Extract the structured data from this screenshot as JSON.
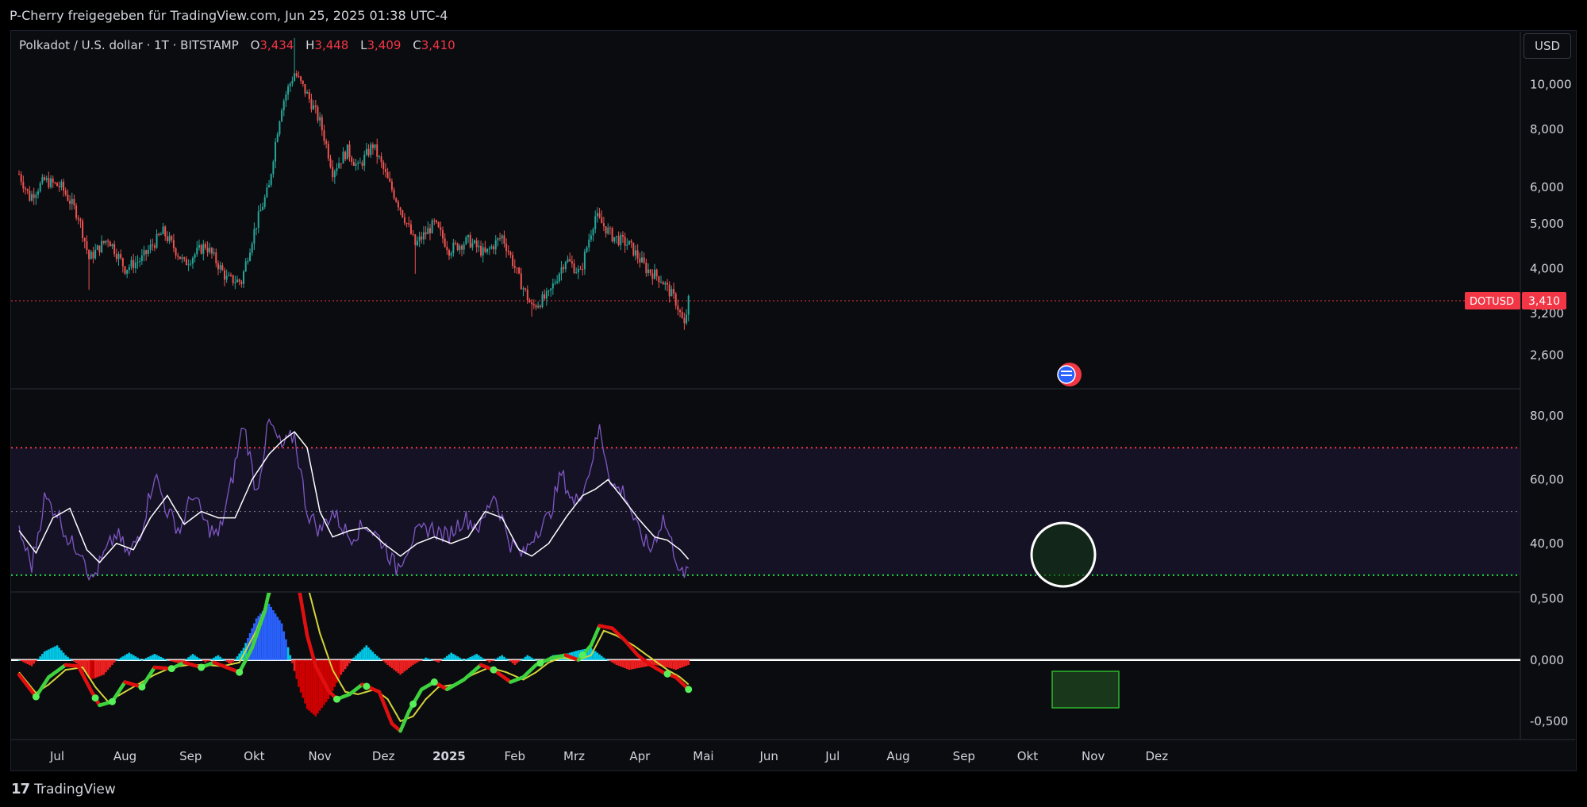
{
  "header": {
    "attribution": "P-Cherry freigegeben für TradingView.com, Jun 25, 2025 01:38 UTC-4"
  },
  "legend": {
    "symbol": "Polkadot / U.S. dollar · 1T · BITSTAMP",
    "o_label": "O",
    "o_value": "3,434",
    "h_label": "H",
    "h_value": "3,448",
    "l_label": "L",
    "l_value": "3,409",
    "c_label": "C",
    "c_value": "3,410"
  },
  "currency_button": "USD",
  "price_tag": {
    "symbol": "DOTUSD",
    "value": "3,410"
  },
  "footer": {
    "brand": "TradingView",
    "logo_mark": "17"
  },
  "colors": {
    "up": "#26a69a",
    "down": "#ef5350",
    "rsi": "#7e57c2",
    "rsi_ma": "#ffffff",
    "upper_band": "#f23645",
    "lower_band": "#22dd44",
    "tag": "#f23645"
  },
  "chart_data": [
    {
      "type": "candlestick",
      "name": "price",
      "scale": "log",
      "ylim": [
        2200,
        13000
      ],
      "y_ticks": [
        {
          "v": 10000,
          "label": "10,000"
        },
        {
          "v": 8000,
          "label": "8,000"
        },
        {
          "v": 6000,
          "label": "6,000"
        },
        {
          "v": 5000,
          "label": "5,000"
        },
        {
          "v": 4000,
          "label": "4,000"
        },
        {
          "v": 3200,
          "label": "3,200"
        },
        {
          "v": 2600,
          "label": "2,600"
        }
      ],
      "last_value": 3410,
      "close_anchors": [
        [
          0,
          6400
        ],
        [
          5,
          5700
        ],
        [
          12,
          6200
        ],
        [
          20,
          6000
        ],
        [
          28,
          5200
        ],
        [
          33,
          4200
        ],
        [
          42,
          4650
        ],
        [
          50,
          4000
        ],
        [
          58,
          4200
        ],
        [
          68,
          4800
        ],
        [
          78,
          4100
        ],
        [
          88,
          4500
        ],
        [
          98,
          3800
        ],
        [
          105,
          3750
        ],
        [
          112,
          5000
        ],
        [
          118,
          6000
        ],
        [
          124,
          9000
        ],
        [
          130,
          10600
        ],
        [
          136,
          9500
        ],
        [
          142,
          8300
        ],
        [
          148,
          6500
        ],
        [
          155,
          7200
        ],
        [
          160,
          6600
        ],
        [
          167,
          7400
        ],
        [
          174,
          6200
        ],
        [
          180,
          5400
        ],
        [
          187,
          4500
        ],
        [
          196,
          5000
        ],
        [
          203,
          4400
        ],
        [
          212,
          4600
        ],
        [
          220,
          4300
        ],
        [
          228,
          4700
        ],
        [
          236,
          3800
        ],
        [
          242,
          3300
        ],
        [
          250,
          3500
        ],
        [
          258,
          4200
        ],
        [
          265,
          3900
        ],
        [
          272,
          5200
        ],
        [
          280,
          4700
        ],
        [
          288,
          4500
        ],
        [
          296,
          4000
        ],
        [
          303,
          3800
        ],
        [
          310,
          3400
        ],
        [
          314,
          3000
        ],
        [
          316,
          3410
        ]
      ],
      "wick_extremes": [
        {
          "i": 33,
          "low": 3600
        },
        {
          "i": 130,
          "high": 12600
        },
        {
          "i": 187,
          "low": 3900
        },
        {
          "i": 242,
          "low": 3150
        },
        {
          "i": 314,
          "low": 2950
        }
      ]
    },
    {
      "type": "line",
      "name": "rsi",
      "ylim": [
        25,
        88
      ],
      "y_ticks": [
        {
          "v": 80,
          "label": "80,00"
        },
        {
          "v": 60,
          "label": "60,00"
        },
        {
          "v": 40,
          "label": "40,00"
        }
      ],
      "bands": {
        "upper": 70,
        "mid": 50,
        "lower": 30
      },
      "rsi_anchors": [
        [
          0,
          44
        ],
        [
          6,
          33
        ],
        [
          12,
          54
        ],
        [
          18,
          50
        ],
        [
          24,
          40
        ],
        [
          30,
          38
        ],
        [
          34,
          28
        ],
        [
          40,
          36
        ],
        [
          46,
          43
        ],
        [
          52,
          36
        ],
        [
          58,
          45
        ],
        [
          64,
          62
        ],
        [
          70,
          50
        ],
        [
          76,
          44
        ],
        [
          82,
          56
        ],
        [
          88,
          46
        ],
        [
          94,
          42
        ],
        [
          100,
          58
        ],
        [
          106,
          78
        ],
        [
          112,
          56
        ],
        [
          118,
          78
        ],
        [
          124,
          70
        ],
        [
          130,
          74
        ],
        [
          136,
          50
        ],
        [
          142,
          44
        ],
        [
          148,
          50
        ],
        [
          156,
          42
        ],
        [
          164,
          46
        ],
        [
          172,
          40
        ],
        [
          178,
          32
        ],
        [
          186,
          42
        ],
        [
          194,
          45
        ],
        [
          202,
          42
        ],
        [
          210,
          48
        ],
        [
          218,
          45
        ],
        [
          224,
          56
        ],
        [
          232,
          40
        ],
        [
          238,
          36
        ],
        [
          244,
          44
        ],
        [
          250,
          48
        ],
        [
          256,
          62
        ],
        [
          262,
          52
        ],
        [
          268,
          60
        ],
        [
          274,
          76
        ],
        [
          280,
          58
        ],
        [
          286,
          56
        ],
        [
          292,
          44
        ],
        [
          298,
          38
        ],
        [
          304,
          48
        ],
        [
          310,
          36
        ],
        [
          314,
          28
        ],
        [
          316,
          34
        ]
      ],
      "ma_anchors": [
        [
          0,
          44
        ],
        [
          8,
          37
        ],
        [
          16,
          48
        ],
        [
          24,
          51
        ],
        [
          32,
          38
        ],
        [
          38,
          34
        ],
        [
          46,
          40
        ],
        [
          54,
          38
        ],
        [
          62,
          48
        ],
        [
          70,
          55
        ],
        [
          78,
          46
        ],
        [
          86,
          50
        ],
        [
          94,
          48
        ],
        [
          102,
          48
        ],
        [
          110,
          60
        ],
        [
          118,
          68
        ],
        [
          124,
          72
        ],
        [
          130,
          75
        ],
        [
          136,
          70
        ],
        [
          142,
          50
        ],
        [
          148,
          42
        ],
        [
          156,
          44
        ],
        [
          164,
          45
        ],
        [
          172,
          40
        ],
        [
          180,
          36
        ],
        [
          188,
          40
        ],
        [
          196,
          42
        ],
        [
          204,
          40
        ],
        [
          212,
          42
        ],
        [
          220,
          50
        ],
        [
          228,
          48
        ],
        [
          236,
          38
        ],
        [
          242,
          36
        ],
        [
          250,
          40
        ],
        [
          258,
          48
        ],
        [
          266,
          55
        ],
        [
          272,
          57
        ],
        [
          278,
          60
        ],
        [
          284,
          55
        ],
        [
          292,
          48
        ],
        [
          300,
          42
        ],
        [
          306,
          41
        ],
        [
          312,
          38
        ],
        [
          316,
          35
        ]
      ]
    },
    {
      "type": "histogram+line",
      "name": "wavetrend",
      "ylim": [
        -0.65,
        0.55
      ],
      "y_ticks": [
        {
          "v": 0.5,
          "label": "0,500"
        },
        {
          "v": 0,
          "label": "0,000"
        },
        {
          "v": -0.5,
          "label": "-0,500"
        }
      ],
      "fast_anchors": [
        [
          0,
          -0.12
        ],
        [
          8,
          -0.3
        ],
        [
          14,
          -0.14
        ],
        [
          22,
          -0.04
        ],
        [
          28,
          -0.05
        ],
        [
          34,
          -0.25
        ],
        [
          38,
          -0.37
        ],
        [
          44,
          -0.34
        ],
        [
          50,
          -0.18
        ],
        [
          58,
          -0.22
        ],
        [
          64,
          -0.06
        ],
        [
          72,
          -0.07
        ],
        [
          78,
          -0.02
        ],
        [
          86,
          -0.06
        ],
        [
          92,
          -0.02
        ],
        [
          98,
          -0.06
        ],
        [
          104,
          -0.1
        ],
        [
          110,
          0.1
        ],
        [
          116,
          0.4
        ],
        [
          120,
          0.72
        ],
        [
          126,
          0.9
        ],
        [
          130,
          0.8
        ],
        [
          136,
          0.2
        ],
        [
          140,
          -0.05
        ],
        [
          146,
          -0.25
        ],
        [
          150,
          -0.32
        ],
        [
          156,
          -0.28
        ],
        [
          162,
          -0.2
        ],
        [
          170,
          -0.26
        ],
        [
          176,
          -0.52
        ],
        [
          180,
          -0.58
        ],
        [
          184,
          -0.42
        ],
        [
          190,
          -0.24
        ],
        [
          196,
          -0.18
        ],
        [
          202,
          -0.24
        ],
        [
          210,
          -0.16
        ],
        [
          218,
          -0.04
        ],
        [
          224,
          -0.08
        ],
        [
          232,
          -0.18
        ],
        [
          238,
          -0.14
        ],
        [
          244,
          -0.04
        ],
        [
          252,
          0.02
        ],
        [
          258,
          0.04
        ],
        [
          264,
          0.0
        ],
        [
          270,
          0.12
        ],
        [
          274,
          0.28
        ],
        [
          280,
          0.26
        ],
        [
          286,
          0.16
        ],
        [
          292,
          0.04
        ],
        [
          298,
          -0.04
        ],
        [
          304,
          -0.1
        ],
        [
          310,
          -0.14
        ],
        [
          316,
          -0.24
        ]
      ],
      "slow_anchors": [
        [
          0,
          -0.1
        ],
        [
          8,
          -0.27
        ],
        [
          14,
          -0.2
        ],
        [
          22,
          -0.08
        ],
        [
          30,
          -0.06
        ],
        [
          36,
          -0.22
        ],
        [
          42,
          -0.34
        ],
        [
          48,
          -0.28
        ],
        [
          56,
          -0.2
        ],
        [
          64,
          -0.12
        ],
        [
          72,
          -0.06
        ],
        [
          80,
          -0.04
        ],
        [
          88,
          -0.04
        ],
        [
          96,
          -0.05
        ],
        [
          104,
          -0.02
        ],
        [
          112,
          0.24
        ],
        [
          118,
          0.52
        ],
        [
          124,
          0.86
        ],
        [
          130,
          0.92
        ],
        [
          136,
          0.62
        ],
        [
          142,
          0.22
        ],
        [
          148,
          -0.08
        ],
        [
          154,
          -0.26
        ],
        [
          160,
          -0.28
        ],
        [
          168,
          -0.24
        ],
        [
          174,
          -0.32
        ],
        [
          180,
          -0.5
        ],
        [
          186,
          -0.46
        ],
        [
          192,
          -0.32
        ],
        [
          198,
          -0.22
        ],
        [
          206,
          -0.2
        ],
        [
          214,
          -0.12
        ],
        [
          222,
          -0.06
        ],
        [
          230,
          -0.1
        ],
        [
          238,
          -0.16
        ],
        [
          244,
          -0.1
        ],
        [
          250,
          -0.02
        ],
        [
          256,
          0.02
        ],
        [
          264,
          0.0
        ],
        [
          270,
          0.04
        ],
        [
          276,
          0.24
        ],
        [
          282,
          0.2
        ],
        [
          290,
          0.12
        ],
        [
          298,
          0.02
        ],
        [
          306,
          -0.08
        ],
        [
          312,
          -0.14
        ],
        [
          316,
          -0.2
        ]
      ],
      "hist_anchors": [
        [
          0,
          0.0
        ],
        [
          6,
          -0.05
        ],
        [
          12,
          0.07
        ],
        [
          18,
          0.12
        ],
        [
          22,
          0.04
        ],
        [
          28,
          -0.04
        ],
        [
          34,
          -0.16
        ],
        [
          40,
          -0.12
        ],
        [
          46,
          0.0
        ],
        [
          52,
          0.06
        ],
        [
          58,
          0.0
        ],
        [
          64,
          0.05
        ],
        [
          70,
          0.0
        ],
        [
          76,
          -0.03
        ],
        [
          82,
          0.05
        ],
        [
          88,
          -0.02
        ],
        [
          94,
          0.04
        ],
        [
          100,
          -0.04
        ],
        [
          106,
          0.1
        ],
        [
          112,
          0.34
        ],
        [
          118,
          0.46
        ],
        [
          124,
          0.3
        ],
        [
          128,
          0.04
        ],
        [
          132,
          -0.22
        ],
        [
          136,
          -0.4
        ],
        [
          140,
          -0.46
        ],
        [
          146,
          -0.32
        ],
        [
          152,
          -0.12
        ],
        [
          158,
          0.02
        ],
        [
          164,
          0.12
        ],
        [
          168,
          0.05
        ],
        [
          174,
          -0.04
        ],
        [
          180,
          -0.12
        ],
        [
          186,
          -0.04
        ],
        [
          192,
          0.02
        ],
        [
          198,
          -0.02
        ],
        [
          204,
          0.06
        ],
        [
          210,
          0.0
        ],
        [
          216,
          0.05
        ],
        [
          222,
          -0.02
        ],
        [
          228,
          0.04
        ],
        [
          234,
          -0.04
        ],
        [
          240,
          0.04
        ],
        [
          246,
          -0.02
        ],
        [
          252,
          0.04
        ],
        [
          258,
          0.05
        ],
        [
          264,
          0.08
        ],
        [
          270,
          0.1
        ],
        [
          276,
          0.02
        ],
        [
          282,
          -0.04
        ],
        [
          288,
          -0.08
        ],
        [
          294,
          -0.06
        ],
        [
          300,
          -0.04
        ],
        [
          306,
          -0.06
        ],
        [
          310,
          -0.08
        ],
        [
          316,
          -0.04
        ]
      ],
      "cross_dots": [
        8,
        36,
        44,
        58,
        72,
        86,
        104,
        150,
        164,
        186,
        196,
        224,
        246,
        266,
        306,
        316
      ]
    }
  ],
  "x_axis": {
    "ticks": [
      {
        "i": 18,
        "label": "Jul"
      },
      {
        "i": 50,
        "label": "Aug"
      },
      {
        "i": 81,
        "label": "Sep"
      },
      {
        "i": 111,
        "label": "Okt"
      },
      {
        "i": 142,
        "label": "Nov"
      },
      {
        "i": 172,
        "label": "Dez"
      },
      {
        "i": 203,
        "label": "2025",
        "bold": true
      },
      {
        "i": 234,
        "label": "Feb"
      },
      {
        "i": 262,
        "label": "Mrz"
      },
      {
        "i": 293,
        "label": "Apr"
      },
      {
        "i": 323,
        "label": "Mai"
      },
      {
        "i": 354,
        "label": "Jun"
      },
      {
        "i": 384,
        "label": "Jul"
      },
      {
        "i": 415,
        "label": "Aug"
      },
      {
        "i": 446,
        "label": "Sep"
      },
      {
        "i": 476,
        "label": "Okt"
      },
      {
        "i": 507,
        "label": "Nov"
      },
      {
        "i": 537,
        "label": "Dez"
      }
    ]
  }
}
